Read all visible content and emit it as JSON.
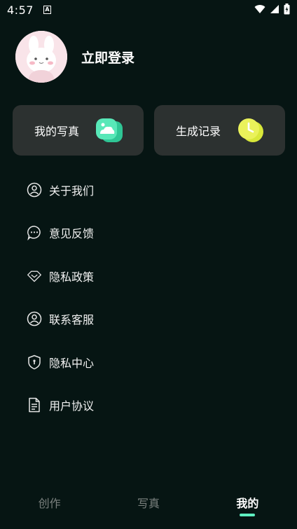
{
  "status_bar": {
    "time": "4:57",
    "notification_icon": "A"
  },
  "profile": {
    "login_label": "立即登录",
    "avatar_icon": "bunny-avatar-icon"
  },
  "cards": [
    {
      "label": "我的写真",
      "icon": "photo-cloud-icon",
      "color": "#4fe3b1"
    },
    {
      "label": "生成记录",
      "icon": "clock-icon",
      "color": "#e4f14a"
    }
  ],
  "menu": {
    "items": [
      {
        "label": "关于我们",
        "icon": "person-circle-icon"
      },
      {
        "label": "意见反馈",
        "icon": "chat-bubble-icon"
      },
      {
        "label": "隐私政策",
        "icon": "diamond-icon"
      },
      {
        "label": "联系客服",
        "icon": "person-circle-icon"
      },
      {
        "label": "隐私中心",
        "icon": "shield-icon"
      },
      {
        "label": "用户协议",
        "icon": "document-icon"
      }
    ]
  },
  "bottom_nav": {
    "tabs": [
      {
        "label": "创作",
        "active": false
      },
      {
        "label": "写真",
        "active": false
      },
      {
        "label": "我的",
        "active": true
      }
    ]
  },
  "colors": {
    "background": "#061513",
    "card": "#2c3130",
    "accent": "#5ff0c0"
  }
}
